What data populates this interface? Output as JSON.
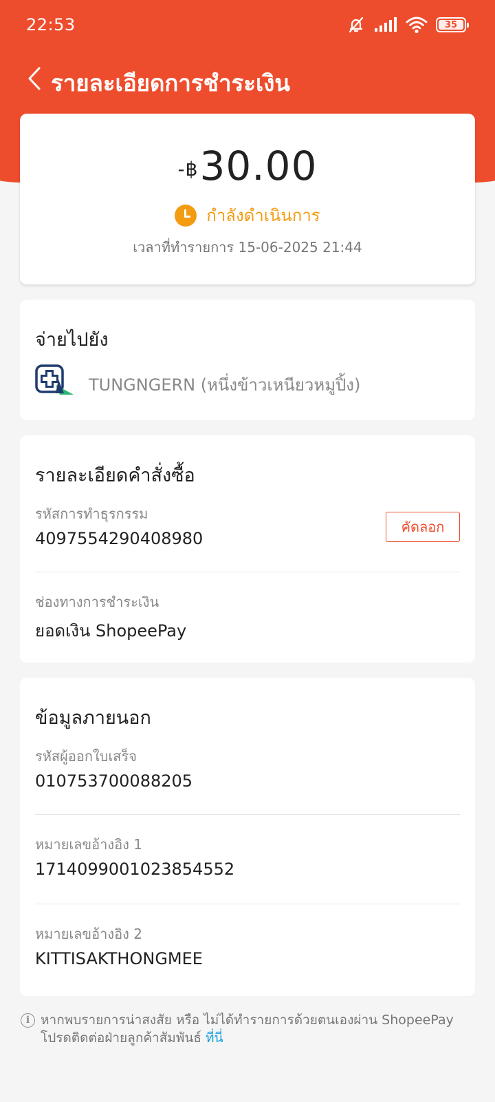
{
  "status_bar": {
    "time": "22:53",
    "battery": "35"
  },
  "nav": {
    "title": "รายละเอียดการชำระเงิน"
  },
  "summary": {
    "amount_prefix": "-฿",
    "amount": "30.00",
    "status": "กำลังดำเนินการ",
    "transaction_time": "เวลาที่ทำรายการ 15-06-2025 21:44"
  },
  "pay_to": {
    "title": "จ่ายไปยัง",
    "merchant": "TUNGNGERN (หนึ่งข้าวเหนียวหมูปิ้ง)"
  },
  "order": {
    "title": "รายละเอียดคำสั่งซื้อ",
    "tx_id_label": "รหัสการทำธุรกรรม",
    "tx_id": "4097554290408980",
    "copy_label": "คัดลอก",
    "method_label": "ช่องทางการชำระเงิน",
    "method": "ยอดเงิน ShopeePay"
  },
  "external": {
    "title": "ข้อมูลภายนอก",
    "issuer_label": "รหัสผู้ออกใบเสร็จ",
    "issuer": "010753700088205",
    "ref1_label": "หมายเลขอ้างอิง 1",
    "ref1": "171409900102385455​2",
    "ref2_label": "หมายเลขอ้างอิง 2",
    "ref2": "KITTISAKTHONGMEE"
  },
  "footer": {
    "note": "หากพบรายการน่าสงสัย หรือ ไม่ได้ทำรายการด้วยตนเองผ่าน ShopeePay โปรดติดต่อฝ่ายลูกค้าสัมพันธ์ ",
    "link": "ที่นี่"
  },
  "colors": {
    "brand": "#ee4d2d",
    "status_pending": "#f39c12",
    "link": "#1aa0e0"
  }
}
